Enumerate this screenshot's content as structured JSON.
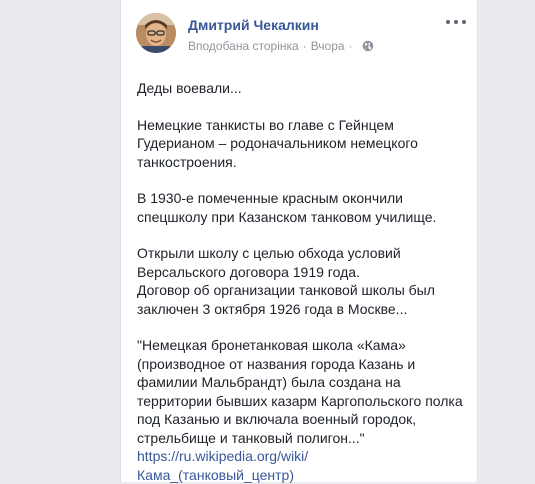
{
  "post": {
    "author": "Дмитрий Чекалкин",
    "subtitle": "Вподобана сторінка",
    "separator": "·",
    "time": "Вчора",
    "paragraphs": [
      "Деды воевали...",
      "Немецкие танкисты во главе с Гейнцем\nГудерианом – родоначальником немецкого\nтанкостроения.",
      "В 1930-е помеченные красным окончили\nспецшколу при Казанском танковом училище.",
      "Открыли школу с целью обхода условий\nВерсальского договора 1919 года.\nДоговор об организации танковой школы был\nзаключен 3 октября 1926 года в Москве...",
      "\"Немецкая бронетанковая школа «Кама»\n(производное от названия города Казань и\nфамилии Мальбрандт) была создана на\nтерритории бывших казарм Каргопольского полка\nпод Казанью и включала военный городок,\nстрельбище и танковый полигон...\""
    ],
    "link": "https://ru.wikipedia.org/wiki/\nКама_(танковый_центр)"
  },
  "icons": {
    "more": "more-options-icon",
    "globe": "globe-icon",
    "avatar": "avatar"
  },
  "colors": {
    "author": "#385898",
    "meta": "#90949c",
    "text": "#1d2129",
    "background": "#e9ebee"
  }
}
